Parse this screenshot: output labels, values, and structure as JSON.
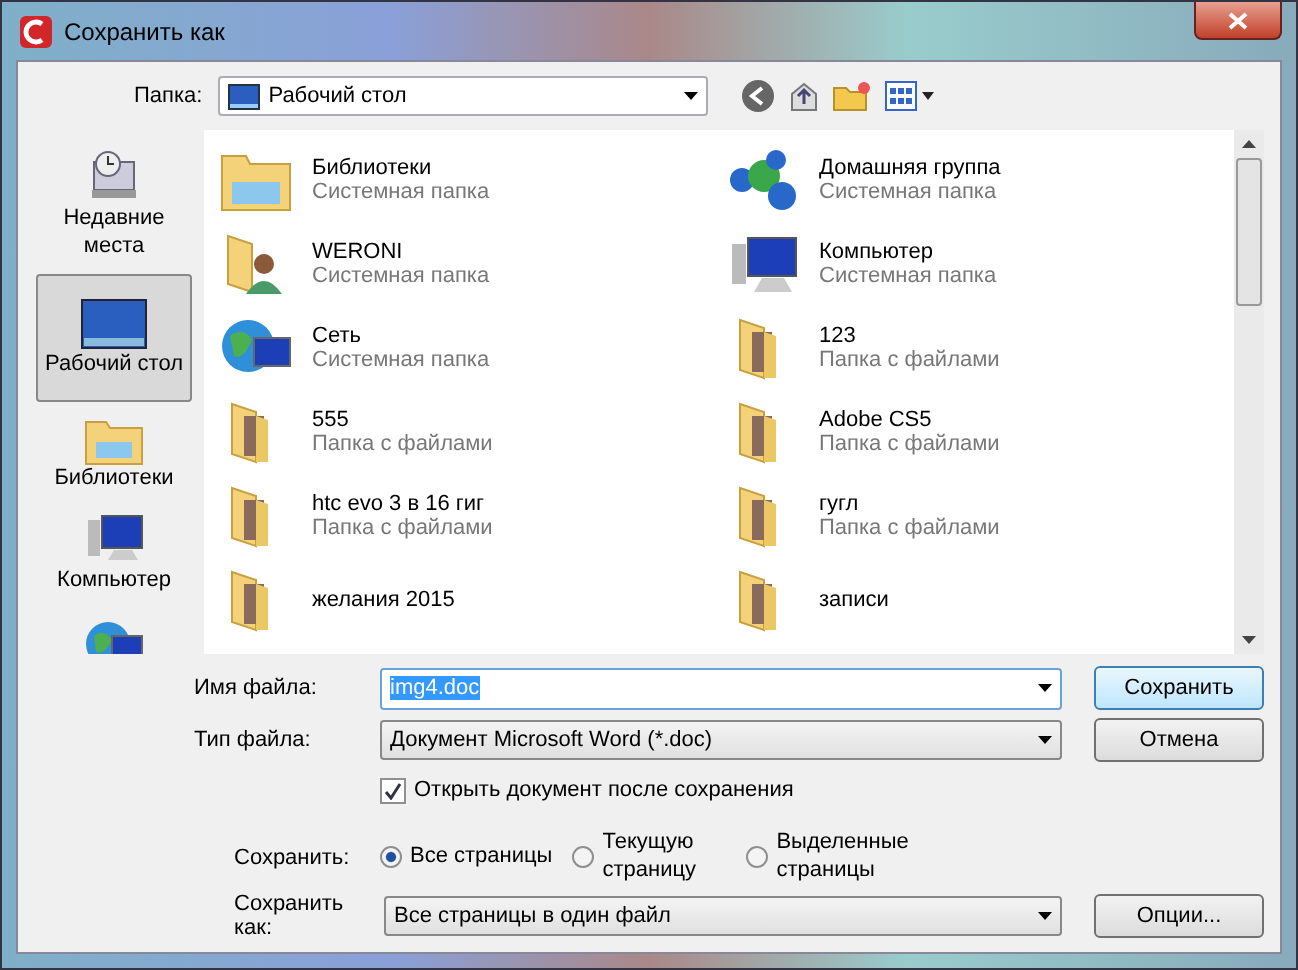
{
  "window": {
    "title": "Сохранить как"
  },
  "toolbar": {
    "label": "Папка:",
    "location": "Рабочий стол"
  },
  "sidebar": {
    "items": [
      {
        "label": "Недавние места",
        "kind": "recent",
        "selected": false
      },
      {
        "label": "Рабочий стол",
        "kind": "desktop",
        "selected": true
      },
      {
        "label": "Библиотеки",
        "kind": "library",
        "selected": false
      },
      {
        "label": "Компьютер",
        "kind": "computer",
        "selected": false
      },
      {
        "kind": "network",
        "selected": false
      }
    ]
  },
  "files": [
    {
      "name": "Библиотеки",
      "type": "Системная папка",
      "kind": "library"
    },
    {
      "name": "Домашняя группа",
      "type": "Системная папка",
      "kind": "homegroup"
    },
    {
      "name": "WERONI",
      "type": "Системная папка",
      "kind": "user"
    },
    {
      "name": "Компьютер",
      "type": "Системная папка",
      "kind": "computer"
    },
    {
      "name": "Сеть",
      "type": "Системная папка",
      "kind": "network"
    },
    {
      "name": "123",
      "type": "Папка с файлами",
      "kind": "folder"
    },
    {
      "name": "555",
      "type": "Папка с файлами",
      "kind": "folder"
    },
    {
      "name": "Adobe CS5",
      "type": "Папка с файлами",
      "kind": "folder"
    },
    {
      "name": "htc evo 3 в 16 гиг",
      "type": "Папка с файлами",
      "kind": "folder"
    },
    {
      "name": "гугл",
      "type": "Папка с файлами",
      "kind": "folder"
    },
    {
      "name": "желания 2015",
      "kind": "folder"
    },
    {
      "name": "записи",
      "kind": "folder"
    }
  ],
  "filename": {
    "label": "Имя файла:",
    "value": "img4.doc",
    "text_selected": true
  },
  "filetype": {
    "label": "Тип файла:",
    "value": "Документ Microsoft Word (*.doc)"
  },
  "open_after": {
    "label": "Открыть документ после сохранения",
    "checked": true
  },
  "save_pages": {
    "label": "Сохранить:",
    "options": [
      {
        "label": "Все страницы",
        "selected": true
      },
      {
        "label": "Текущую страницу",
        "selected": false
      },
      {
        "label": "Выделенные страницы",
        "selected": false
      }
    ]
  },
  "save_as": {
    "label": "Сохранить как:",
    "value": "Все страницы в один файл"
  },
  "buttons": {
    "save": "Сохранить",
    "cancel": "Отмена",
    "options": "Опции..."
  }
}
